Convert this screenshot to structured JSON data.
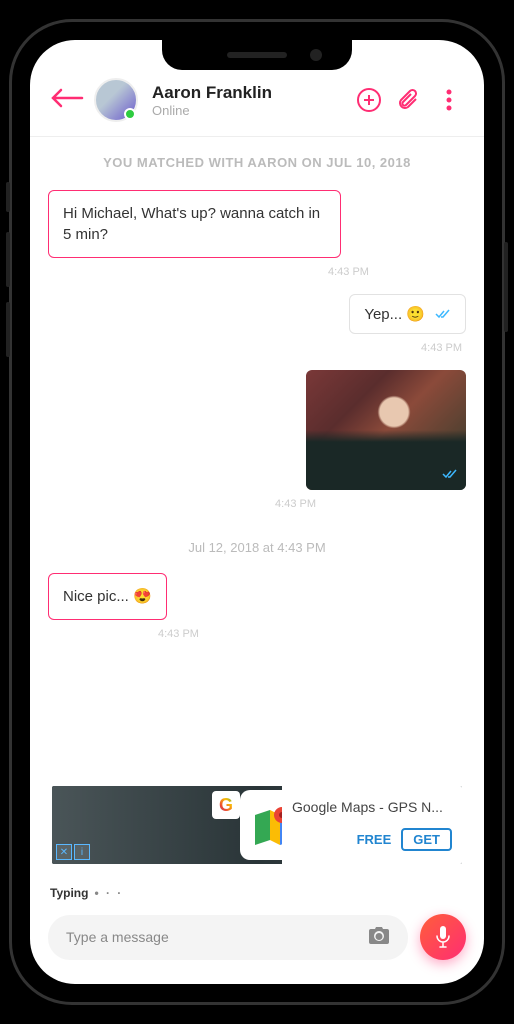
{
  "header": {
    "contact_name": "Aaron Franklin",
    "status": "Online"
  },
  "match_banner": "YOU MATCHED WITH AARON ON JUL 10, 2018",
  "messages": {
    "m1_text": "Hi Michael, What's up? wanna catch in 5 min?",
    "m1_time": "4:43 PM",
    "m2_text": "Yep... 🙂",
    "m2_time": "4:43 PM",
    "m3_time": "4:43 PM",
    "date_sep": "Jul 12, 2018 at 4:43 PM",
    "m4_text": "Nice pic... 😍",
    "m4_time": "4:43 PM"
  },
  "ad": {
    "badge": "G",
    "title": "Google Maps - GPS N...",
    "free_label": "FREE",
    "get_label": "GET"
  },
  "typing": {
    "label": "Typing",
    "dots": "• · ·"
  },
  "input": {
    "placeholder": "Type a message"
  }
}
